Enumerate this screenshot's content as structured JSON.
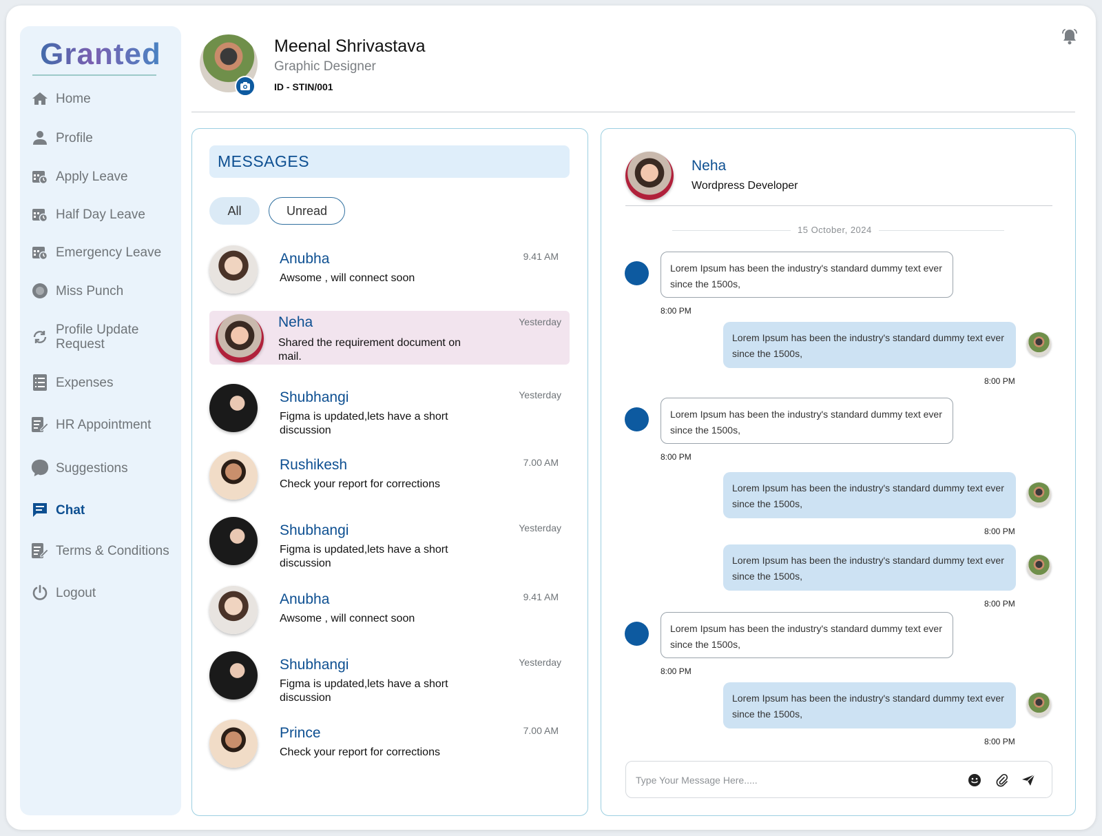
{
  "app": {
    "logo": "Granted"
  },
  "sidebar": {
    "items": [
      {
        "label": "Home",
        "icon": "home-icon"
      },
      {
        "label": "Profile",
        "icon": "user-icon"
      },
      {
        "label": "Apply Leave",
        "icon": "calendar-icon"
      },
      {
        "label": "Half Day Leave",
        "icon": "calendar-icon"
      },
      {
        "label": "Emergency Leave",
        "icon": "calendar-icon"
      },
      {
        "label": "Miss Punch",
        "icon": "circle-icon"
      },
      {
        "label": "Profile Update\nRequest",
        "icon": "refresh-icon"
      },
      {
        "label": "Expenses",
        "icon": "list-icon"
      },
      {
        "label": "HR Appointment",
        "icon": "edit-document-icon"
      },
      {
        "label": "Suggestions",
        "icon": "speech-bubble-icon"
      },
      {
        "label": "Chat",
        "icon": "chat-icon",
        "active": true
      },
      {
        "label": "Terms & Conditions",
        "icon": "edit-document-icon"
      },
      {
        "label": "Logout",
        "icon": "power-icon"
      }
    ]
  },
  "user": {
    "name": "Meenal Shrivastava",
    "role": "Graphic Designer",
    "id": "ID - STIN/001"
  },
  "messages": {
    "title": "MESSAGES",
    "filters": {
      "all": "All",
      "unread": "Unread"
    },
    "conversations": [
      {
        "name": "Anubha",
        "preview": "Awsome , will connect soon",
        "time": "9.41 AM",
        "avatar": "anubha"
      },
      {
        "name": "Neha",
        "preview": "Shared the requirement document on mail.",
        "time": "Yesterday",
        "avatar": "neha",
        "active": true
      },
      {
        "name": "Shubhangi",
        "preview": "Figma is updated,lets have a short discussion",
        "time": "Yesterday",
        "avatar": "shubhangi"
      },
      {
        "name": "Rushikesh",
        "preview": "Check your report for corrections",
        "time": "7.00 AM",
        "avatar": "rushikesh"
      },
      {
        "name": "Shubhangi",
        "preview": "Figma is updated,lets have a short discussion",
        "time": "Yesterday",
        "avatar": "shubhangi"
      },
      {
        "name": "Anubha",
        "preview": "Awsome , will connect soon",
        "time": "9.41 AM",
        "avatar": "anubha"
      },
      {
        "name": "Shubhangi",
        "preview": "Figma is updated,lets have a short discussion",
        "time": "Yesterday",
        "avatar": "shubhangi"
      },
      {
        "name": "Prince",
        "preview": "Check your report for corrections",
        "time": "7.00 AM",
        "avatar": "rushikesh"
      }
    ]
  },
  "chat": {
    "contact": {
      "name": "Neha",
      "role": "Wordpress Developer"
    },
    "date": "15 October, 2024",
    "messages": [
      {
        "dir": "in",
        "text": "Lorem Ipsum has been the industry's standard dummy text ever since the 1500s,",
        "time": "8:00 PM"
      },
      {
        "dir": "out",
        "text": "Lorem Ipsum has been the industry's standard dummy text ever since the 1500s,",
        "time": "8:00 PM"
      },
      {
        "dir": "in",
        "text": "Lorem Ipsum has been the industry's standard dummy text ever since the 1500s,",
        "time": "8:00 PM"
      },
      {
        "dir": "out",
        "text": "Lorem Ipsum has been the industry's standard dummy text ever since the 1500s,",
        "time": "8:00 PM"
      },
      {
        "dir": "out",
        "text": "Lorem Ipsum has been the industry's standard dummy text ever since the 1500s,",
        "time": "8:00 PM"
      },
      {
        "dir": "in",
        "text": "Lorem Ipsum has been the industry's standard dummy text ever since the 1500s,",
        "time": "8:00 PM"
      },
      {
        "dir": "out",
        "text": "Lorem Ipsum has been the industry's standard dummy text ever since the 1500s,",
        "time": "8:00 PM"
      }
    ],
    "composer": {
      "placeholder": "Type Your Message Here....."
    }
  },
  "colors": {
    "accent": "#0d4f91",
    "bubble_out": "#cde2f3",
    "sidebar_bg": "#eaf3fb",
    "active_row": "#f2e4ee",
    "panel_border": "#9ccfe1"
  }
}
